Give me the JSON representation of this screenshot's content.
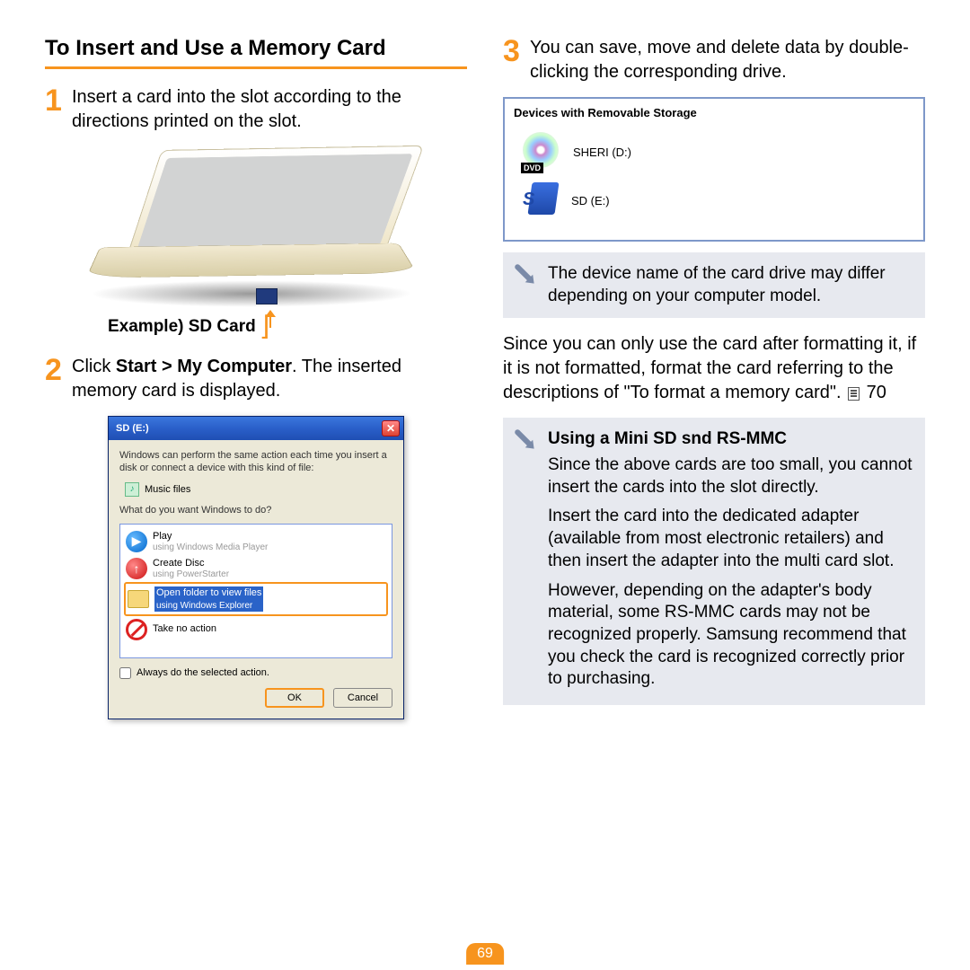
{
  "left": {
    "title": "To Insert and Use a Memory Card",
    "step1": "Insert a card into the slot according to the directions printed on the slot.",
    "example_label": "Example) SD Card",
    "step2_pre": "Click ",
    "step2_bold": "Start > My Computer",
    "step2_post": ". The inserted memory card is displayed.",
    "xp": {
      "title": "SD (E:)",
      "desc": "Windows can perform the same action each time you insert a disk or connect a device with this kind of file:",
      "music": "Music files",
      "prompt": "What do you want Windows to do?",
      "play": "Play",
      "play_sub": "using Windows Media Player",
      "create": "Create Disc",
      "create_sub": "using PowerStarter",
      "open": "Open folder to view files",
      "open_sub": "using Windows Explorer",
      "none": "Take no action",
      "always": "Always do the selected action.",
      "ok": "OK",
      "cancel": "Cancel"
    }
  },
  "right": {
    "step3": "You can save, move and delete data by double-clicking the corresponding drive.",
    "dev_hdr": "Devices with Removable Storage",
    "dvd": "SHERI (D:)",
    "dvd_tag": "DVD",
    "sd": "SD (E:)",
    "note1": "The device name of the card drive may differ depending on your computer model.",
    "format_para_a": "Since you can only use the card after formatting it, if it is not formatted, format the card referring to the descriptions of \"To format a memory card\". ",
    "format_ref": "70",
    "mini_title": "Using a Mini SD snd RS-MMC",
    "mini_p1": "Since the above cards are too small, you cannot insert the cards into the slot directly.",
    "mini_p2": "Insert the card into the dedicated adapter (available from most electronic retailers) and then insert the adapter into the multi card slot.",
    "mini_p3": "However, depending on the adapter's body material, some RS-MMC cards may not be recognized properly. Samsung recommend that you check the card is recognized correctly prior to purchasing."
  },
  "page_number": "69"
}
